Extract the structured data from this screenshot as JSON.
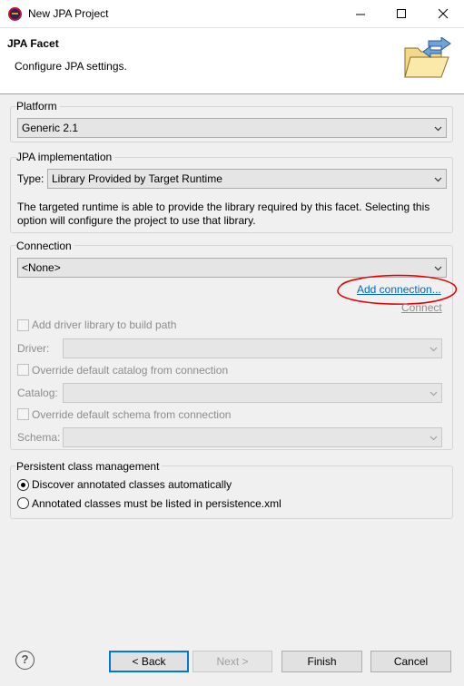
{
  "window": {
    "title": "New JPA Project"
  },
  "header": {
    "title": "JPA Facet",
    "description": "Configure JPA settings."
  },
  "platform": {
    "label": "Platform",
    "selected": "Generic 2.1"
  },
  "jpa_impl": {
    "label": "JPA implementation",
    "type_label": "Type:",
    "type_selected": "Library Provided by Target Runtime",
    "description_line1": "The targeted runtime is able to provide the library required by this facet. Selecting this",
    "description_line2": "option will configure the project to use that library."
  },
  "connection": {
    "label": "Connection",
    "selected": "<None>",
    "add_connection": "Add connection...",
    "connect": "Connect",
    "add_driver": "Add driver library to build path",
    "driver_label": "Driver:",
    "override_catalog": "Override default catalog from connection",
    "catalog_label": "Catalog:",
    "override_schema": "Override default schema from connection",
    "schema_label": "Schema:"
  },
  "persistent": {
    "label": "Persistent class management",
    "option1": "Discover annotated classes automatically",
    "option2": "Annotated classes must be listed in persistence.xml",
    "selected_option": 1
  },
  "buttons": {
    "back": "< Back",
    "next": "Next >",
    "finish": "Finish",
    "cancel": "Cancel",
    "help": "?"
  },
  "colors": {
    "link": "#0066cc",
    "annotation": "#e00000",
    "default_button_border": "#0078d7"
  }
}
